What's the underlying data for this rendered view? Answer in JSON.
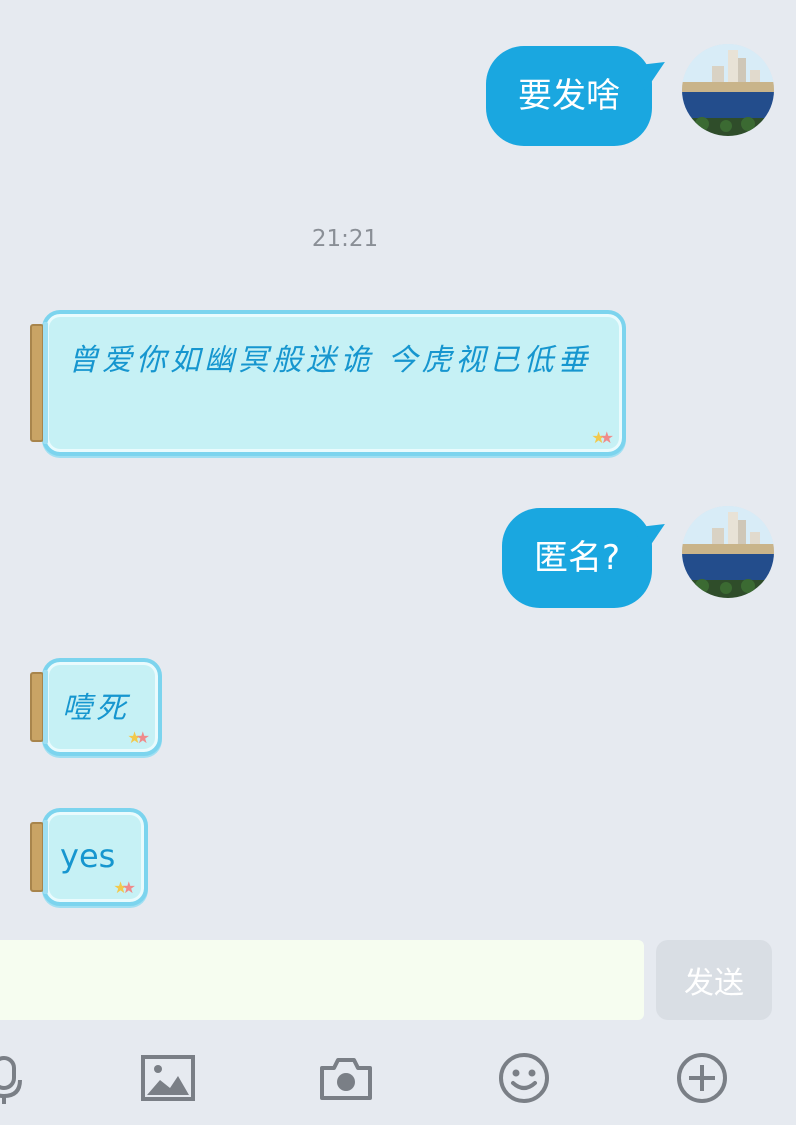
{
  "messages": {
    "out1": "要发啥",
    "timestamp": "21:21",
    "in1": "曾爱你如幽冥般迷诡 今虎视已低垂",
    "out2": "匿名?",
    "in2": "噎死",
    "in3": "yes"
  },
  "input": {
    "placeholder": "",
    "send_label": "发送"
  },
  "toolbar": {
    "icons": [
      "microphone-icon",
      "image-icon",
      "camera-icon",
      "emoji-icon",
      "plus-icon"
    ]
  },
  "colors": {
    "outgoing_bubble": "#1aa7e0",
    "incoming_text": "#1696cf",
    "jar_fill": "#c6f1f5",
    "background": "#e6eaf0"
  }
}
